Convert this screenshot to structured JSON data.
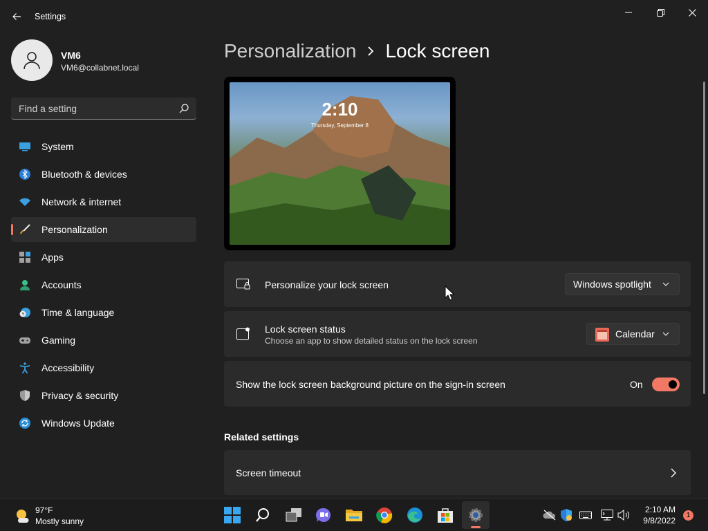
{
  "window": {
    "title": "Settings"
  },
  "user": {
    "name": "VM6",
    "email": "VM6@collabnet.local"
  },
  "search": {
    "placeholder": "Find a setting"
  },
  "sidebar": {
    "items": [
      {
        "label": "System",
        "icon": "system-icon"
      },
      {
        "label": "Bluetooth & devices",
        "icon": "bluetooth-icon"
      },
      {
        "label": "Network & internet",
        "icon": "wifi-icon"
      },
      {
        "label": "Personalization",
        "icon": "brush-icon",
        "active": true
      },
      {
        "label": "Apps",
        "icon": "apps-icon"
      },
      {
        "label": "Accounts",
        "icon": "accounts-icon"
      },
      {
        "label": "Time & language",
        "icon": "clock-globe-icon"
      },
      {
        "label": "Gaming",
        "icon": "gamepad-icon"
      },
      {
        "label": "Accessibility",
        "icon": "accessibility-icon"
      },
      {
        "label": "Privacy & security",
        "icon": "shield-icon"
      },
      {
        "label": "Windows Update",
        "icon": "update-icon"
      }
    ]
  },
  "breadcrumb": {
    "parent": "Personalization",
    "current": "Lock screen"
  },
  "preview": {
    "time": "2:10",
    "date": "Thursday, September 8"
  },
  "settings": {
    "personalize": {
      "title": "Personalize your lock screen",
      "value": "Windows spotlight"
    },
    "status": {
      "title": "Lock screen status",
      "subtitle": "Choose an app to show detailed status on the lock screen",
      "value": "Calendar"
    },
    "signin": {
      "title": "Show the lock screen background picture on the sign-in screen",
      "state": "On"
    }
  },
  "related": {
    "header": "Related settings",
    "items": [
      {
        "label": "Screen timeout"
      }
    ]
  },
  "taskbar": {
    "weather": {
      "temp": "97°F",
      "desc": "Mostly sunny"
    },
    "clock": {
      "time": "2:10 AM",
      "date": "9/8/2022"
    },
    "notifications": "1"
  },
  "colors": {
    "accent": "#f07864",
    "background": "#202020",
    "card": "#2b2b2b"
  }
}
